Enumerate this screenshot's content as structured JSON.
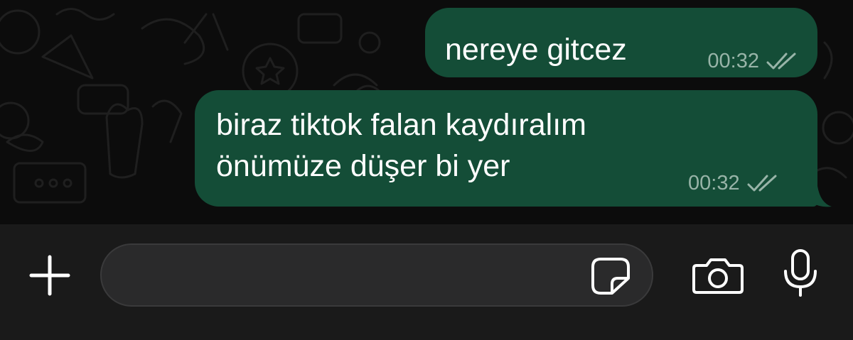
{
  "messages": [
    {
      "text": "nereye gitcez",
      "time": "00:32",
      "status": "read"
    },
    {
      "text": "biraz tiktok falan kaydıralım\nönümüze düşer bi yer",
      "time": "00:32",
      "status": "read"
    }
  ],
  "composer": {
    "placeholder": "",
    "icons": {
      "attach": "plus-icon",
      "sticker": "sticker-icon",
      "camera": "camera-icon",
      "voice": "microphone-icon"
    }
  },
  "colors": {
    "background": "#0c0c0c",
    "outgoing_bubble": "#144d37",
    "composer_bar": "#1a1a1a",
    "input_field": "#2a2a2b",
    "meta_text": "#98b4a8"
  }
}
